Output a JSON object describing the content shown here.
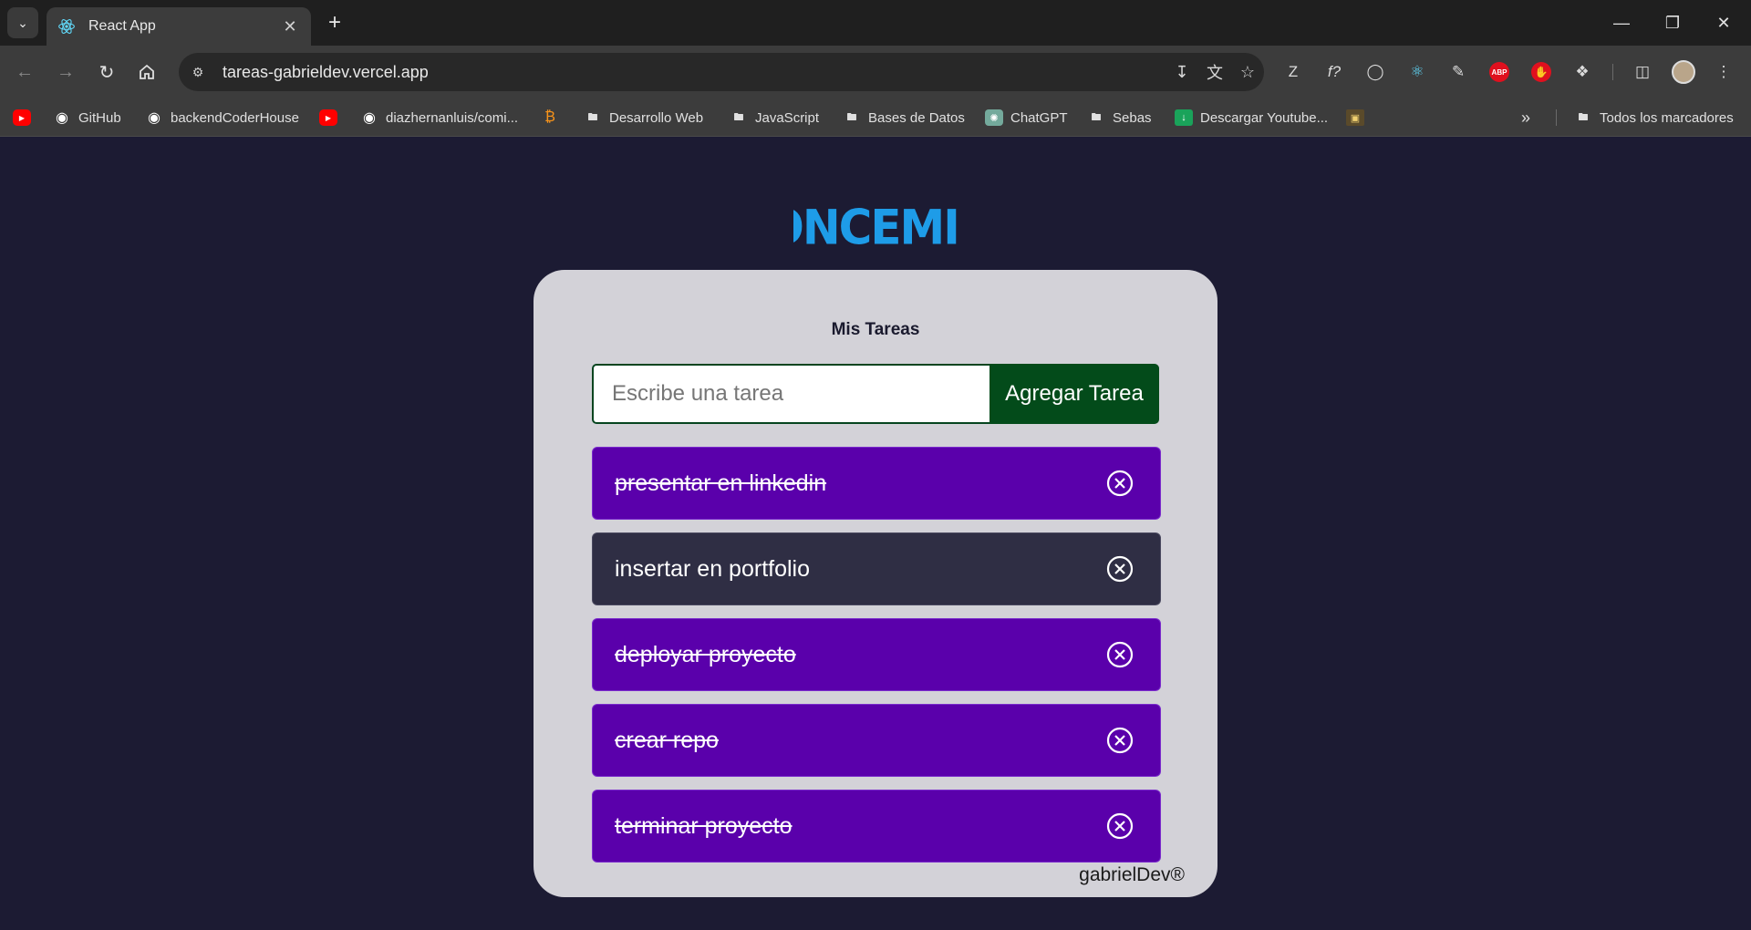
{
  "browser": {
    "tab_title": "React App",
    "url": "tareas-gabrieldev.vercel.app",
    "bookmarks": [
      {
        "label": "",
        "icon": "youtube-icon"
      },
      {
        "label": "GitHub",
        "icon": "github-icon"
      },
      {
        "label": "backendCoderHouse",
        "icon": "github-icon"
      },
      {
        "label": "",
        "icon": "youtube-icon"
      },
      {
        "label": "diazhernanluis/comi...",
        "icon": "github-icon"
      },
      {
        "label": "",
        "icon": "bitcoin-icon"
      },
      {
        "label": "Desarrollo Web",
        "icon": "folder-icon"
      },
      {
        "label": "JavaScript",
        "icon": "folder-icon"
      },
      {
        "label": "Bases de Datos",
        "icon": "folder-icon"
      },
      {
        "label": "ChatGPT",
        "icon": "chatgpt-icon"
      },
      {
        "label": "Sebas",
        "icon": "folder-icon"
      },
      {
        "label": "Descargar Youtube...",
        "icon": "download-icon"
      },
      {
        "label": "",
        "icon": "image-icon"
      }
    ],
    "all_bookmarks_label": "Todos los marcadores"
  },
  "app": {
    "logo_text": "ONCEMIL",
    "title": "Mis Tareas",
    "input_placeholder": "Escribe una tarea",
    "add_button_label": "Agregar Tarea",
    "tasks": [
      {
        "text": "presentar en linkedin",
        "completed": true
      },
      {
        "text": "insertar en portfolio",
        "completed": false
      },
      {
        "text": "deployar proyecto",
        "completed": true
      },
      {
        "text": "crear repo",
        "completed": true
      },
      {
        "text": "terminar proyecto",
        "completed": true
      }
    ],
    "footer_brand": "gabrielDev®"
  },
  "colors": {
    "page_bg": "#1c1b33",
    "card_bg": "#d3d2d8",
    "completed_task": "#5a00ab",
    "pending_task": "#2f2e44",
    "add_button": "#034b1a",
    "logo": "#1e9ce8"
  }
}
